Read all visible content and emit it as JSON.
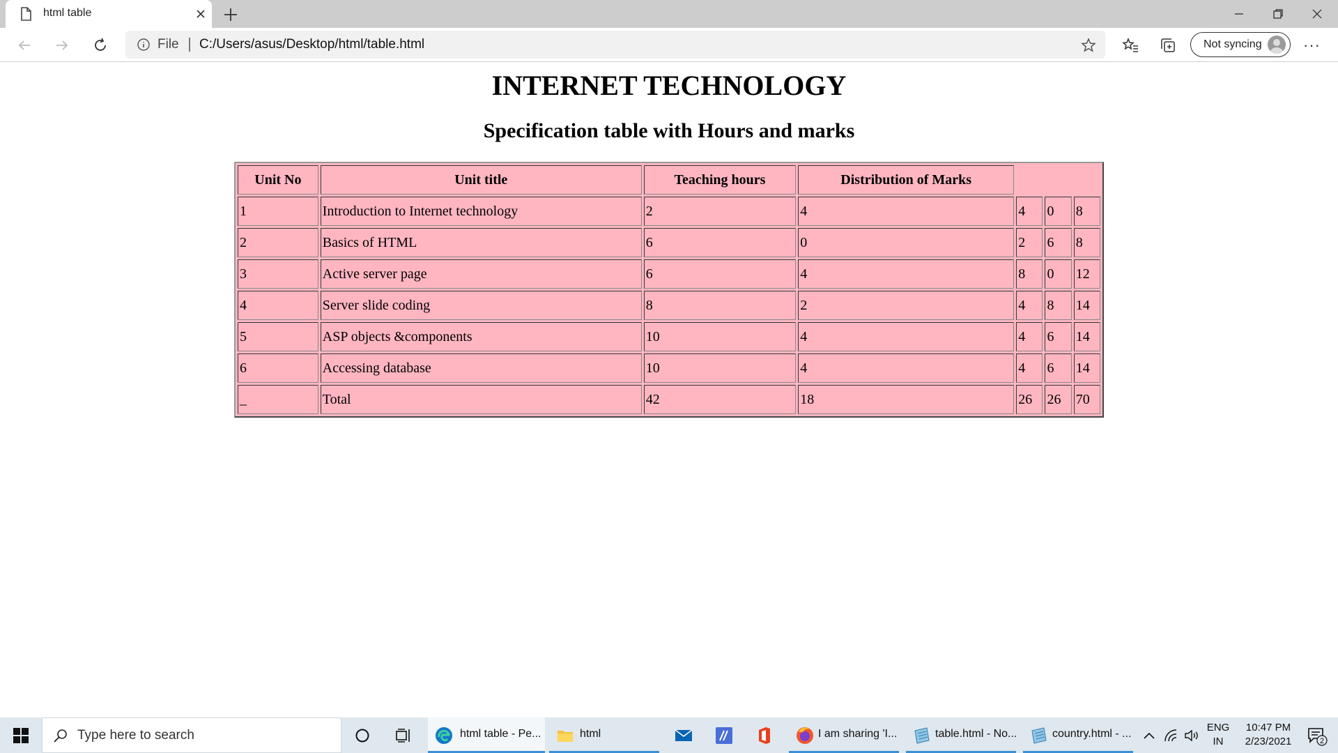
{
  "browser": {
    "tab_title": "html table",
    "file_label": "File",
    "url": "C:/Users/asus/Desktop/html/table.html",
    "sync_label": "Not syncing"
  },
  "page": {
    "heading": "INTERNET TECHNOLOGY",
    "subheading": "Specification table with Hours and marks",
    "table": {
      "headers": [
        "Unit No",
        "Unit title",
        "Teaching hours",
        "Distribution of Marks"
      ],
      "rows": [
        [
          "1",
          "Introduction to Internet technology",
          "2",
          "4",
          "4",
          "0",
          "8"
        ],
        [
          "2",
          "Basics of HTML",
          "6",
          "0",
          "2",
          "6",
          "8"
        ],
        [
          "3",
          "Active server page",
          "6",
          "4",
          "8",
          "0",
          "12"
        ],
        [
          "4",
          "Server slide coding",
          "8",
          "2",
          "4",
          "8",
          "14"
        ],
        [
          "5",
          "ASP objects &components",
          "10",
          "4",
          "4",
          "6",
          "14"
        ],
        [
          "6",
          "Accessing database",
          "10",
          "4",
          "4",
          "6",
          "14"
        ],
        [
          "_",
          "Total",
          "42",
          "18",
          "26",
          "26",
          "70"
        ]
      ]
    }
  },
  "taskbar": {
    "search_placeholder": "Type here to search",
    "apps": [
      {
        "label": "html table - Pe...",
        "icon": "edge-icon"
      },
      {
        "label": "html",
        "icon": "folder-icon"
      },
      {
        "label": "",
        "icon": "mail-icon"
      },
      {
        "label": "",
        "icon": "app-icon"
      },
      {
        "label": "",
        "icon": "office-icon"
      },
      {
        "label": "I am sharing 'I...",
        "icon": "firefox-icon"
      },
      {
        "label": "table.html - No...",
        "icon": "notepad-icon"
      },
      {
        "label": "country.html - ...",
        "icon": "notepad-icon"
      }
    ],
    "lang_top": "ENG",
    "lang_bottom": "IN",
    "time": "10:47 PM",
    "date": "2/23/2021",
    "notification_count": "2"
  },
  "colors": {
    "table_bg": "#ffb6c1",
    "tabstrip_bg": "#cdcdcd",
    "taskbar_bg": "#dfe8ee",
    "accent": "#3b8fd6"
  }
}
